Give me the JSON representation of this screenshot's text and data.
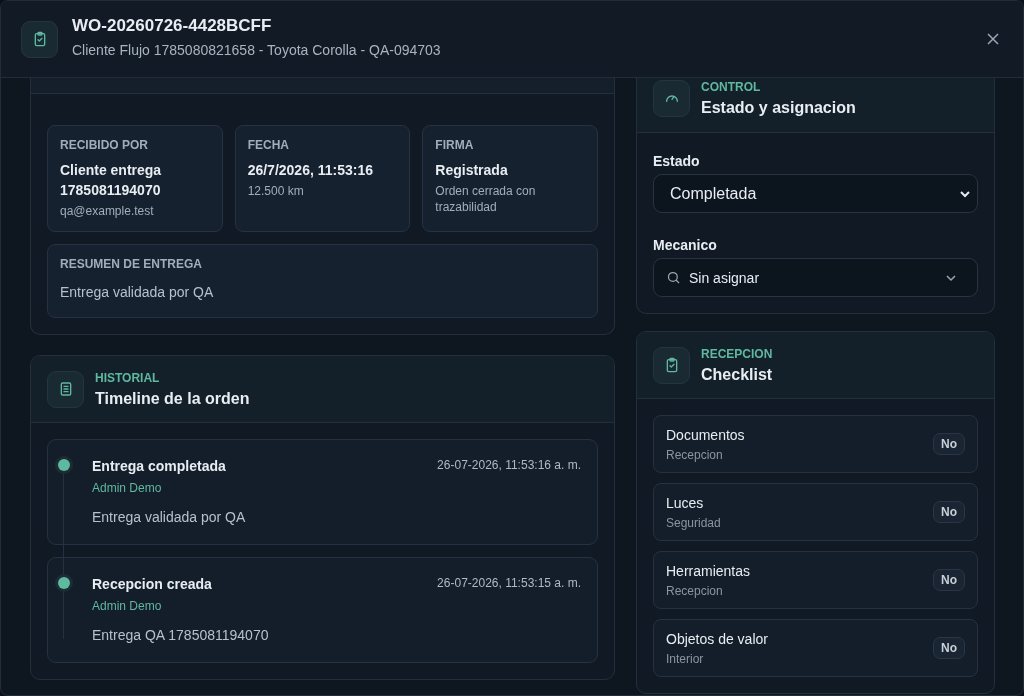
{
  "header": {
    "title": "WO-20260726-4428BCFF",
    "subtitle": "Cliente Flujo 1785080821658 - Toyota Corolla - QA-094703"
  },
  "delivery": {
    "fields": [
      {
        "label": "RECIBIDO POR",
        "value": "Cliente entrega 1785081194070",
        "detail": "qa@example.test"
      },
      {
        "label": "FECHA",
        "value": "26/7/2026, 11:53:16",
        "detail": "12.500 km"
      },
      {
        "label": "FIRMA",
        "value": "Registrada",
        "detail": "Orden cerrada con trazabilidad"
      }
    ],
    "summary": {
      "label": "RESUMEN DE ENTREGA",
      "text": "Entrega validada por QA"
    }
  },
  "timeline": {
    "eyebrow": "HISTORIAL",
    "title": "Timeline de la orden",
    "events": [
      {
        "title": "Entrega completada",
        "author": "Admin Demo",
        "time": "26-07-2026, 11:53:16 a. m.",
        "note": "Entrega validada por QA"
      },
      {
        "title": "Recepcion creada",
        "author": "Admin Demo",
        "time": "26-07-2026, 11:53:15 a. m.",
        "note": "Entrega QA 1785081194070"
      }
    ]
  },
  "control": {
    "eyebrow": "CONTROL",
    "title": "Estado y asignacion",
    "estado": {
      "label": "Estado",
      "value": "Completada"
    },
    "mecanico": {
      "label": "Mecanico",
      "value": "Sin asignar"
    }
  },
  "checklist": {
    "eyebrow": "RECEPCION",
    "title": "Checklist",
    "items": [
      {
        "name": "Documentos",
        "category": "Recepcion",
        "answer": "No"
      },
      {
        "name": "Luces",
        "category": "Seguridad",
        "answer": "No"
      },
      {
        "name": "Herramientas",
        "category": "Recepcion",
        "answer": "No"
      },
      {
        "name": "Objetos de valor",
        "category": "Interior",
        "answer": "No"
      }
    ]
  }
}
